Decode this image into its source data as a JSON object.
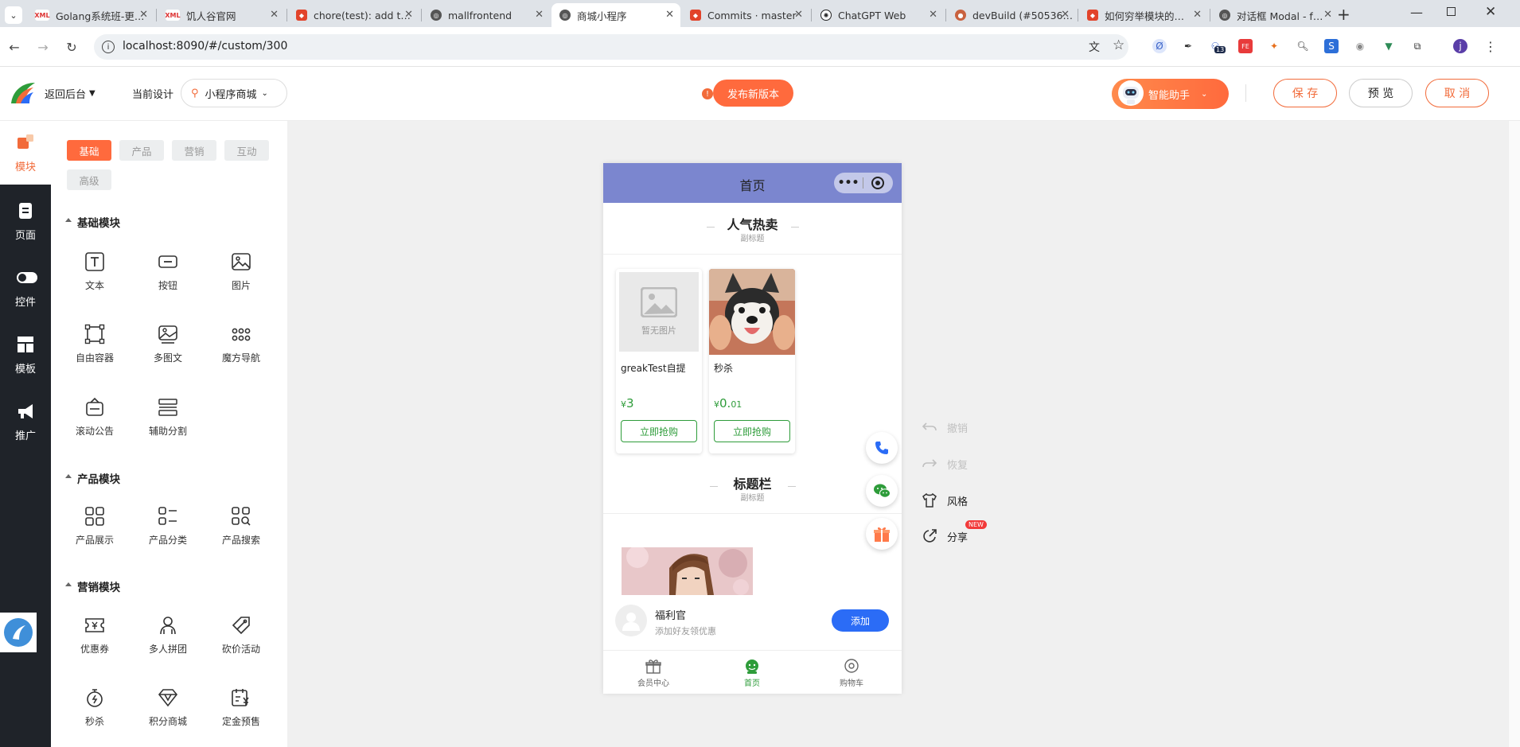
{
  "browser": {
    "tabs": [
      {
        "title": "Golang系统班-更…",
        "icon": "xml-icon"
      },
      {
        "title": "饥人谷官网",
        "icon": "xml-icon"
      },
      {
        "title": "chore(test): add t…",
        "icon": "gitlab-icon"
      },
      {
        "title": "mallfrontend",
        "icon": "globe-icon"
      },
      {
        "title": "商城小程序",
        "icon": "globe-icon"
      },
      {
        "title": "Commits · master",
        "icon": "gitlab-icon"
      },
      {
        "title": "ChatGPT Web",
        "icon": "openai-icon"
      },
      {
        "title": "devBuild (#50536…",
        "icon": "devbuild-icon"
      },
      {
        "title": "如何穷举模块的…",
        "icon": "gitlab-icon"
      },
      {
        "title": "对话框 Modal - f…",
        "icon": "globe-icon"
      }
    ],
    "url": "localhost:8090/#/custom/300",
    "ext_badge": "13",
    "profile_letter": "j"
  },
  "header": {
    "back_label": "返回后台",
    "current_design_label": "当前设计",
    "design_select": "小程序商城",
    "publish_label": "发布新版本",
    "assistant_label": "智能助手",
    "save_label": "保 存",
    "preview_label": "预 览",
    "cancel_label": "取 消"
  },
  "rail": {
    "items": [
      "模块",
      "页面",
      "控件",
      "模板",
      "推广"
    ]
  },
  "panel": {
    "tabs": [
      "基础",
      "产品",
      "营销",
      "互动",
      "高级"
    ],
    "sections": [
      {
        "title": "基础模块",
        "items": [
          "文本",
          "按钮",
          "图片",
          "自由容器",
          "多图文",
          "魔方导航",
          "滚动公告",
          "辅助分割"
        ]
      },
      {
        "title": "产品模块",
        "items": [
          "产品展示",
          "产品分类",
          "产品搜索"
        ]
      },
      {
        "title": "营销模块",
        "items": [
          "优惠券",
          "多人拼团",
          "砍价活动",
          "秒杀",
          "积分商城",
          "定金预售"
        ]
      }
    ]
  },
  "phone": {
    "page_title": "首页",
    "hot_title": "人气热卖",
    "hot_subtitle": "副标题",
    "no_image": "暂无图片",
    "products": [
      {
        "name": "greakTest自提",
        "price_symbol": "¥",
        "price_int": "3",
        "price_dec": "",
        "buy": "立即抢购"
      },
      {
        "name": "秒杀",
        "price_symbol": "¥",
        "price_int": "0.",
        "price_dec": "01",
        "buy": "立即抢购"
      }
    ],
    "title_bar": "标题栏",
    "title_bar_subtitle": "副标题",
    "welfare_name": "福利官",
    "welfare_desc": "添加好友领优惠",
    "add_label": "添加",
    "tabbar": [
      {
        "label": "会员中心"
      },
      {
        "label": "首页"
      },
      {
        "label": "购物车"
      }
    ]
  },
  "tools": {
    "undo": "撤销",
    "redo": "恢复",
    "style": "风格",
    "share": "分享",
    "new_badge": "NEW"
  },
  "colors": {
    "accent": "#ff6a3d",
    "phone_title": "#7b86cf",
    "green": "#2e9c3a",
    "blue": "#2b6cf6"
  }
}
